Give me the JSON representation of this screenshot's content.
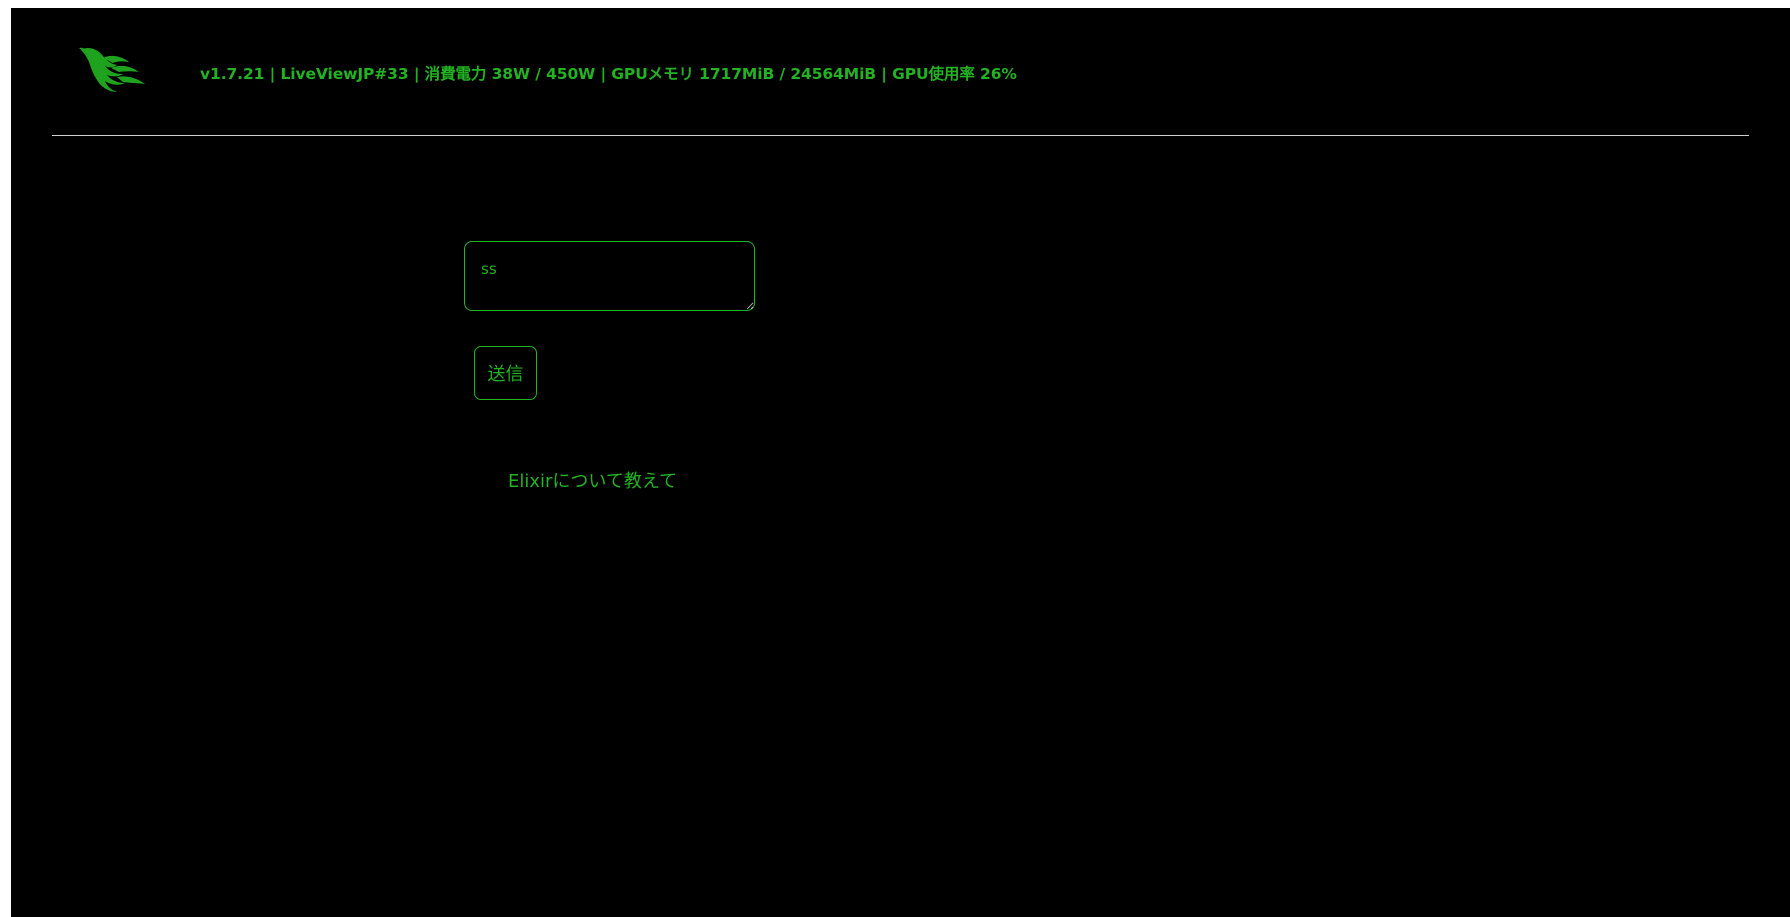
{
  "header": {
    "status_text": "v1.7.21 | LiveViewJP#33 | 消費電力 38W / 450W | GPUメモリ 1717MiB / 24564MiB | GPU使用率 26%",
    "logo_icon": "phoenix-logo-icon"
  },
  "form": {
    "input_value": "ss",
    "submit_label": "送信"
  },
  "response": {
    "text": "Elixirについて教えて"
  },
  "colors": {
    "background": "#000000",
    "accent": "#22b222",
    "divider": "#cfcfcf"
  }
}
